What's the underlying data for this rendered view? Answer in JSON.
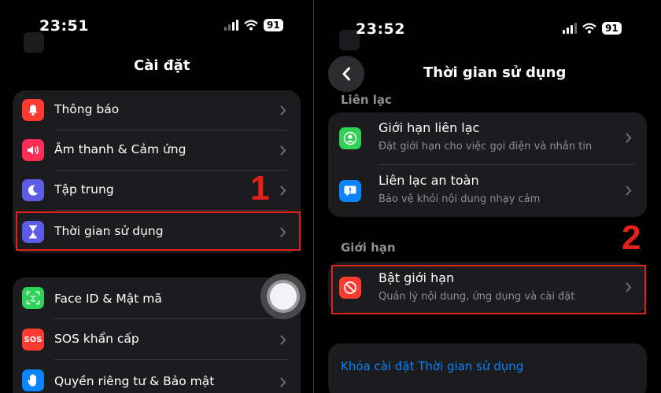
{
  "colors": {
    "accent_red": "#e3201b",
    "link_blue": "#0a84ff"
  },
  "left": {
    "status_time": "23:51",
    "battery": "91",
    "nav_title": "Cài đặt",
    "group1": [
      {
        "label": "Thông báo",
        "icon": "bell-icon",
        "color": "#ff3b30"
      },
      {
        "label": "Âm thanh & Cảm ứng",
        "icon": "speaker-icon",
        "color": "#ff2d55"
      },
      {
        "label": "Tập trung",
        "icon": "moon-icon",
        "color": "#5e5ce6"
      },
      {
        "label": "Thời gian sử dụng",
        "icon": "hourglass-icon",
        "color": "#5e5ce6"
      }
    ],
    "group2": [
      {
        "label": "Face ID & Mật mã",
        "icon": "face-id-icon",
        "color": "#30d158"
      },
      {
        "label": "SOS khẩn cấp",
        "icon": "sos-icon",
        "color": "#ff3b30",
        "icon_text": "SOS"
      },
      {
        "label": "Quyền riêng tư & Bảo mật",
        "icon": "hand-icon",
        "color": "#0a84ff"
      }
    ],
    "step": "1"
  },
  "right": {
    "status_time": "23:52",
    "battery": "91",
    "nav_title": "Thời gian sử dụng",
    "section_contacts": "Liên lạc",
    "contacts": [
      {
        "title": "Giới hạn liên lạc",
        "subtitle": "Đặt giới hạn cho việc gọi điện và nhắn tin",
        "icon": "contact-person-icon",
        "color": "#30d158"
      },
      {
        "title": "Liên lạc an toàn",
        "subtitle": "Bảo vệ khỏi nội dung nhạy cảm",
        "icon": "chat-bubble-icon",
        "color": "#0a84ff"
      }
    ],
    "section_limits": "Giới hạn",
    "restrictions": {
      "title": "Bật giới hạn",
      "subtitle": "Quản lý nội dung, ứng dụng và cài đặt",
      "icon": "no-entry-icon",
      "color": "#ff3b30"
    },
    "lock_link": "Khóa cài đặt Thời gian sử dụng",
    "step": "2"
  }
}
